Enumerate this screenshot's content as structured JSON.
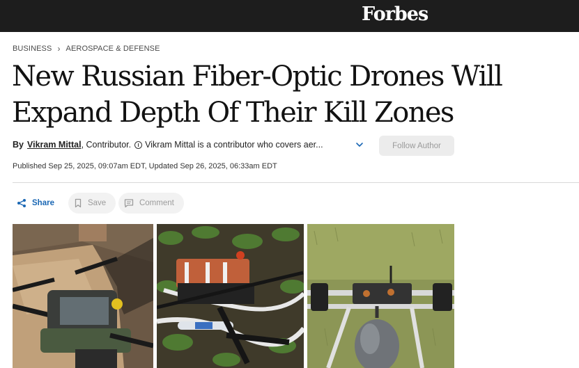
{
  "header": {
    "logo": "Forbes"
  },
  "breadcrumb": {
    "section": "BUSINESS",
    "subsection": "AEROSPACE & DEFENSE"
  },
  "article": {
    "headline": "New Russian Fiber-Optic Drones Will Expand Depth Of Their Kill Zones",
    "byline_prefix": "By",
    "author": "Vikram Mittal",
    "role": ", Contributor.",
    "bio": "Vikram Mittal is a contributor who covers aer...",
    "follow_label": "Follow Author",
    "published": "Published Sep 25, 2025, 09:07am EDT, Updated Sep 26, 2025, 06:33am EDT"
  },
  "actions": {
    "share": "Share",
    "save": "Save",
    "comment": "Comment"
  },
  "colors": {
    "accent": "#1a67b4",
    "topbar": "#1d1d1d"
  },
  "icons": [
    "share-icon",
    "bookmark-icon",
    "comment-icon",
    "info-icon",
    "chevron-down-icon"
  ]
}
